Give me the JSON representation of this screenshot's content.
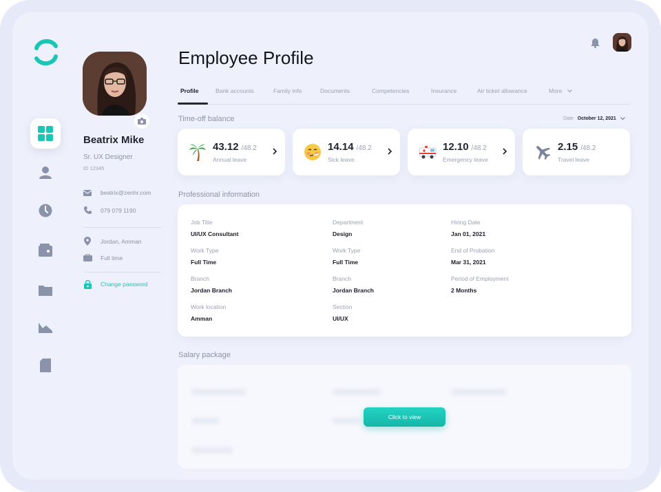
{
  "page": {
    "title": "Employee Profile"
  },
  "profile": {
    "name": "Beatrix Mike",
    "role": "Sr. UX Designer",
    "id": "ID 12345",
    "email": "beatrix@zenhr.com",
    "phone": "079 079 1190",
    "location": "Jordan, Amman",
    "employment": "Full time",
    "change_password": "Change password"
  },
  "tabs": [
    {
      "label": "Profile",
      "active": true
    },
    {
      "label": "Bank accounts"
    },
    {
      "label": "Family info"
    },
    {
      "label": "Documents"
    },
    {
      "label": "Competencies"
    },
    {
      "label": "Insurance"
    },
    {
      "label": "Air ticket allowance"
    },
    {
      "label": "More"
    }
  ],
  "timeoff": {
    "title": "Time-off balance",
    "date_label": "Date",
    "date_value": "October 12, 2021",
    "cards": [
      {
        "value": "43.12",
        "total": "/48.2",
        "label": "Annual leave",
        "icon": "palm-tree-icon"
      },
      {
        "value": "14.14",
        "total": "/48.2",
        "label": "Sick leave",
        "icon": "sick-face-icon"
      },
      {
        "value": "12.10",
        "total": "/48.2",
        "label": "Emergency leave",
        "icon": "ambulance-icon"
      },
      {
        "value": "2.15",
        "total": "/48.2",
        "label": "Travel leave",
        "icon": "airplane-icon"
      }
    ]
  },
  "professional": {
    "title": "Professional information",
    "fields": [
      {
        "label": "Job Title",
        "value": "UI/UX Consultant"
      },
      {
        "label": "Department",
        "value": "Design"
      },
      {
        "label": "Hiring Date",
        "value": "Jan 01, 2021"
      },
      {
        "label": "Work Type",
        "value": "Full Time"
      },
      {
        "label": "Work Type",
        "value": "Full Time"
      },
      {
        "label": "End of Probation",
        "value": "Mar 31, 2021"
      },
      {
        "label": "Branch",
        "value": "Jordan Branch"
      },
      {
        "label": "Branch",
        "value": "Jordan Branch"
      },
      {
        "label": "Period of Employment",
        "value": "2 Months"
      },
      {
        "label": "Work location",
        "value": "Amman"
      },
      {
        "label": "Section",
        "value": "UI/UX"
      }
    ]
  },
  "salary": {
    "title": "Salary package",
    "cta": "Click to view"
  },
  "colors": {
    "accent": "#1cc6b6",
    "background": "#eef1fb",
    "text_dark": "#1b1e27",
    "text_muted": "#9aa1b3"
  }
}
